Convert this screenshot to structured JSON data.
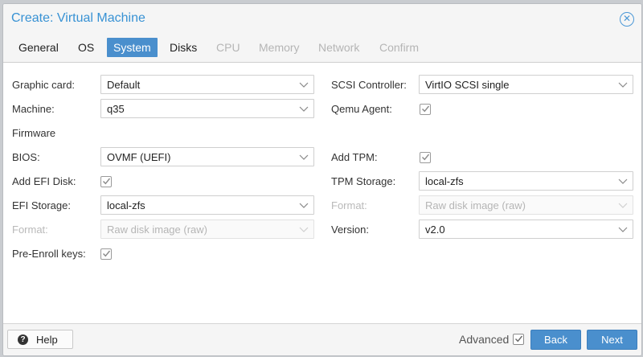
{
  "dialog": {
    "title": "Create: Virtual Machine"
  },
  "tabs": [
    {
      "label": "General",
      "state": "normal"
    },
    {
      "label": "OS",
      "state": "normal"
    },
    {
      "label": "System",
      "state": "active"
    },
    {
      "label": "Disks",
      "state": "normal"
    },
    {
      "label": "CPU",
      "state": "disabled"
    },
    {
      "label": "Memory",
      "state": "disabled"
    },
    {
      "label": "Network",
      "state": "disabled"
    },
    {
      "label": "Confirm",
      "state": "disabled"
    }
  ],
  "left": {
    "graphic_card": {
      "label": "Graphic card:",
      "value": "Default"
    },
    "machine": {
      "label": "Machine:",
      "value": "q35"
    },
    "firmware_heading": "Firmware",
    "bios": {
      "label": "BIOS:",
      "value": "OVMF (UEFI)"
    },
    "add_efi_disk": {
      "label": "Add EFI Disk:",
      "checked": true
    },
    "efi_storage": {
      "label": "EFI Storage:",
      "value": "local-zfs"
    },
    "format": {
      "label": "Format:",
      "value": "Raw disk image (raw)"
    },
    "pre_enroll_keys": {
      "label": "Pre-Enroll keys:",
      "checked": true
    }
  },
  "right": {
    "scsi_controller": {
      "label": "SCSI Controller:",
      "value": "VirtIO SCSI single"
    },
    "qemu_agent": {
      "label": "Qemu Agent:",
      "checked": true
    },
    "add_tpm": {
      "label": "Add TPM:",
      "checked": true
    },
    "tpm_storage": {
      "label": "TPM Storage:",
      "value": "local-zfs"
    },
    "format": {
      "label": "Format:",
      "value": "Raw disk image (raw)"
    },
    "version": {
      "label": "Version:",
      "value": "v2.0"
    }
  },
  "footer": {
    "help_label": "Help",
    "advanced_label": "Advanced",
    "advanced_checked": true,
    "back_label": "Back",
    "next_label": "Next"
  },
  "colors": {
    "accent": "#4a8fcd",
    "title": "#3892d4",
    "disabled_text": "#b5b5b5"
  }
}
